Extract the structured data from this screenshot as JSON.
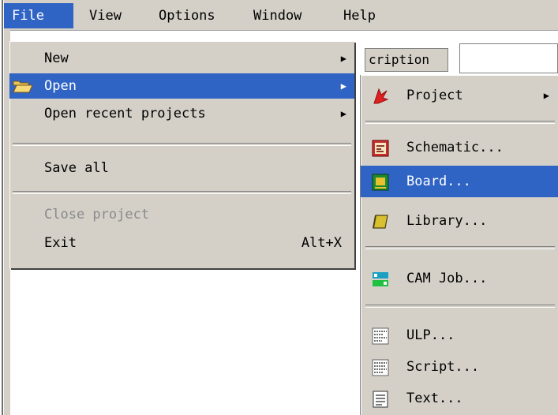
{
  "menubar": {
    "items": [
      {
        "label": "File"
      },
      {
        "label": "View"
      },
      {
        "label": "Options"
      },
      {
        "label": "Window"
      },
      {
        "label": "Help"
      }
    ]
  },
  "background": {
    "field_text": "cription"
  },
  "file_menu": {
    "items": [
      {
        "label": "New"
      },
      {
        "label": "Open"
      },
      {
        "label": "Open recent projects"
      },
      {
        "label": "Save all"
      },
      {
        "label": "Close project"
      },
      {
        "label": "Exit",
        "shortcut": "Alt+X"
      }
    ]
  },
  "open_submenu": {
    "items": [
      {
        "label": "Project",
        "icon": "project-icon"
      },
      {
        "label": "Schematic...",
        "icon": "schematic-icon"
      },
      {
        "label": "Board...",
        "icon": "board-icon"
      },
      {
        "label": "Library...",
        "icon": "library-icon"
      },
      {
        "label": "CAM Job...",
        "icon": "cam-job-icon"
      },
      {
        "label": "ULP...",
        "icon": "ulp-icon"
      },
      {
        "label": "Script...",
        "icon": "script-icon"
      },
      {
        "label": "Text...",
        "icon": "text-icon"
      }
    ]
  },
  "colors": {
    "highlight": "#2f63c4",
    "menu_bg": "#d4d0c8"
  }
}
